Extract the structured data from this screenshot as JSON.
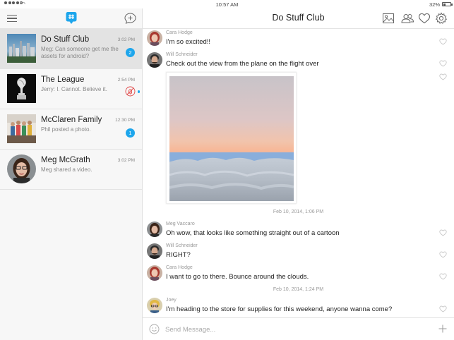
{
  "status_bar": {
    "time": "10:57 AM",
    "battery": "32%"
  },
  "colors": {
    "accent": "#1ea6ec",
    "active_row": "#e3e3e3"
  },
  "sidebar": {
    "conversations": [
      {
        "name": "Do Stuff Club",
        "preview": "Meg: Can someone get me the assets for android?",
        "time": "3:02 PM",
        "badge": "2",
        "active": true,
        "thumb": "city-photo"
      },
      {
        "name": "The League",
        "preview": "Jerry: I. Cannot. Believe it.",
        "time": "2:54 PM",
        "muted": true,
        "thumb": "trophy-photo"
      },
      {
        "name": "McClaren Family",
        "preview": "Phil posted a photo.",
        "time": "12:30 PM",
        "badge": "1",
        "thumb": "family-photo"
      },
      {
        "name": "Meg McGrath",
        "preview": "Meg shared a video.",
        "time": "3:02 PM",
        "thumb": "person-photo"
      }
    ]
  },
  "header": {
    "title": "Do Stuff Club"
  },
  "messages": [
    {
      "sender": "Cara Hodge",
      "text": "I'm so excited!!"
    },
    {
      "sender": "Will Schneider",
      "text": "Check out the view from the plane on the flight over"
    },
    {
      "date": "Feb 10, 2014, 1:06 PM"
    },
    {
      "sender": "Meg Vaccaro",
      "text": "Oh wow, that looks like something straight out of a cartoon"
    },
    {
      "sender": "Will Schneider",
      "text": "RIGHT?"
    },
    {
      "sender": "Cara Hodge",
      "text": "I want to go to there. Bounce around the clouds."
    },
    {
      "date": "Feb 10, 2014, 1:24 PM"
    },
    {
      "sender": "Joey",
      "text": "I'm heading to the store for supplies for this weekend, anyone wanna come?"
    }
  ],
  "composer": {
    "placeholder": "Send Message..."
  }
}
